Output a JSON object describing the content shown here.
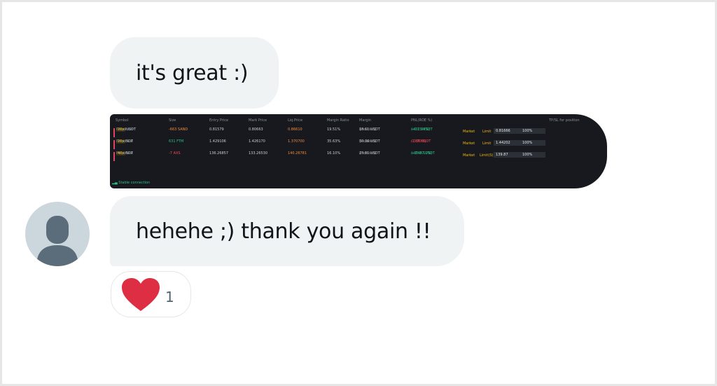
{
  "messages": [
    {
      "text": "it's great :)"
    },
    {
      "text": "hehehe ;) thank you again !!"
    }
  ],
  "attachment": {
    "columns": [
      "Symbol",
      "Size",
      "Entry Price",
      "Mark Price",
      "Liq.Price",
      "Margin Ratio",
      "Margin",
      "PNL(ROE %)",
      "TP/SL for position"
    ],
    "rows": [
      {
        "symbol": "SANDUSDT",
        "leverage": "20x",
        "type": "Perpetual",
        "size": "-663 SAND",
        "entry": "0.81579",
        "mark": "0.80663",
        "liq": "0.86610",
        "ratio": "19.51%",
        "margin": "18.61 USDT",
        "margin_mode": "(Isolated)",
        "pnl": "+6.13 USDT",
        "roe": "(+32.94%)",
        "order_type": "Market",
        "limit": "Limit",
        "price": "0.81666",
        "pct": "100%"
      },
      {
        "symbol": "FTMUSDT",
        "leverage": "20x",
        "type": "Perpetual",
        "size": "631 FTM",
        "entry": "1.429106",
        "mark": "1.426170",
        "liq": "1.370700",
        "ratio": "35.63%",
        "margin": "50.36 USDT",
        "margin_mode": "(Isolated)",
        "pnl": "-1.86 USDT",
        "roe": "(-3.70%)",
        "order_type": "Market",
        "limit": "Limit",
        "price": "1.44202",
        "pct": "100%"
      },
      {
        "symbol": "AXSUSDT",
        "leverage": "40x",
        "type": "Perpetual",
        "size": "-7 AXS",
        "entry": "136.26857",
        "mark": "133.26530",
        "liq": "140.26781",
        "ratio": "16.10%",
        "margin": "23.81 USDT",
        "margin_mode": "(Isolated)",
        "pnl": "+35.87 USDT",
        "roe": "(+148.12%)",
        "order_type": "Market",
        "limit": "Limit(S)",
        "price": "139.87",
        "pct": "100%"
      }
    ],
    "footer": "Stable connection"
  },
  "reaction": {
    "emoji": "heart-icon",
    "count": "1",
    "color": "#e0245e"
  },
  "colors": {
    "bubble": "#eff3f4",
    "text": "#0f1419",
    "screenshot_bg": "#17191e"
  }
}
